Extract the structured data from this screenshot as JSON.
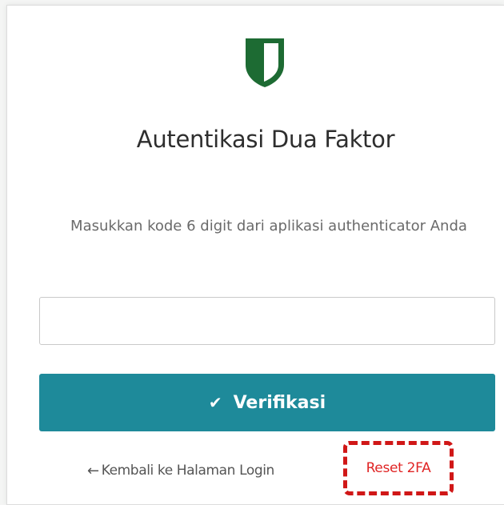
{
  "header": {
    "title": "Autentikasi Dua Faktor",
    "logo_icon": "shield-icon"
  },
  "form": {
    "instruction": "Masukkan kode 6 digit dari aplikasi authenticator Anda",
    "code_value": "",
    "code_placeholder": "",
    "verify_label": "Verifikasi",
    "verify_icon": "check-icon"
  },
  "footer": {
    "back_label": "Kembali ke Halaman Login",
    "back_icon": "arrow-left-icon",
    "reset_label": "Reset 2FA"
  },
  "colors": {
    "primary": "#1e8a9a",
    "shield_green": "#1d6b33",
    "reset_red": "#e02525",
    "highlight_red": "#d01717"
  }
}
